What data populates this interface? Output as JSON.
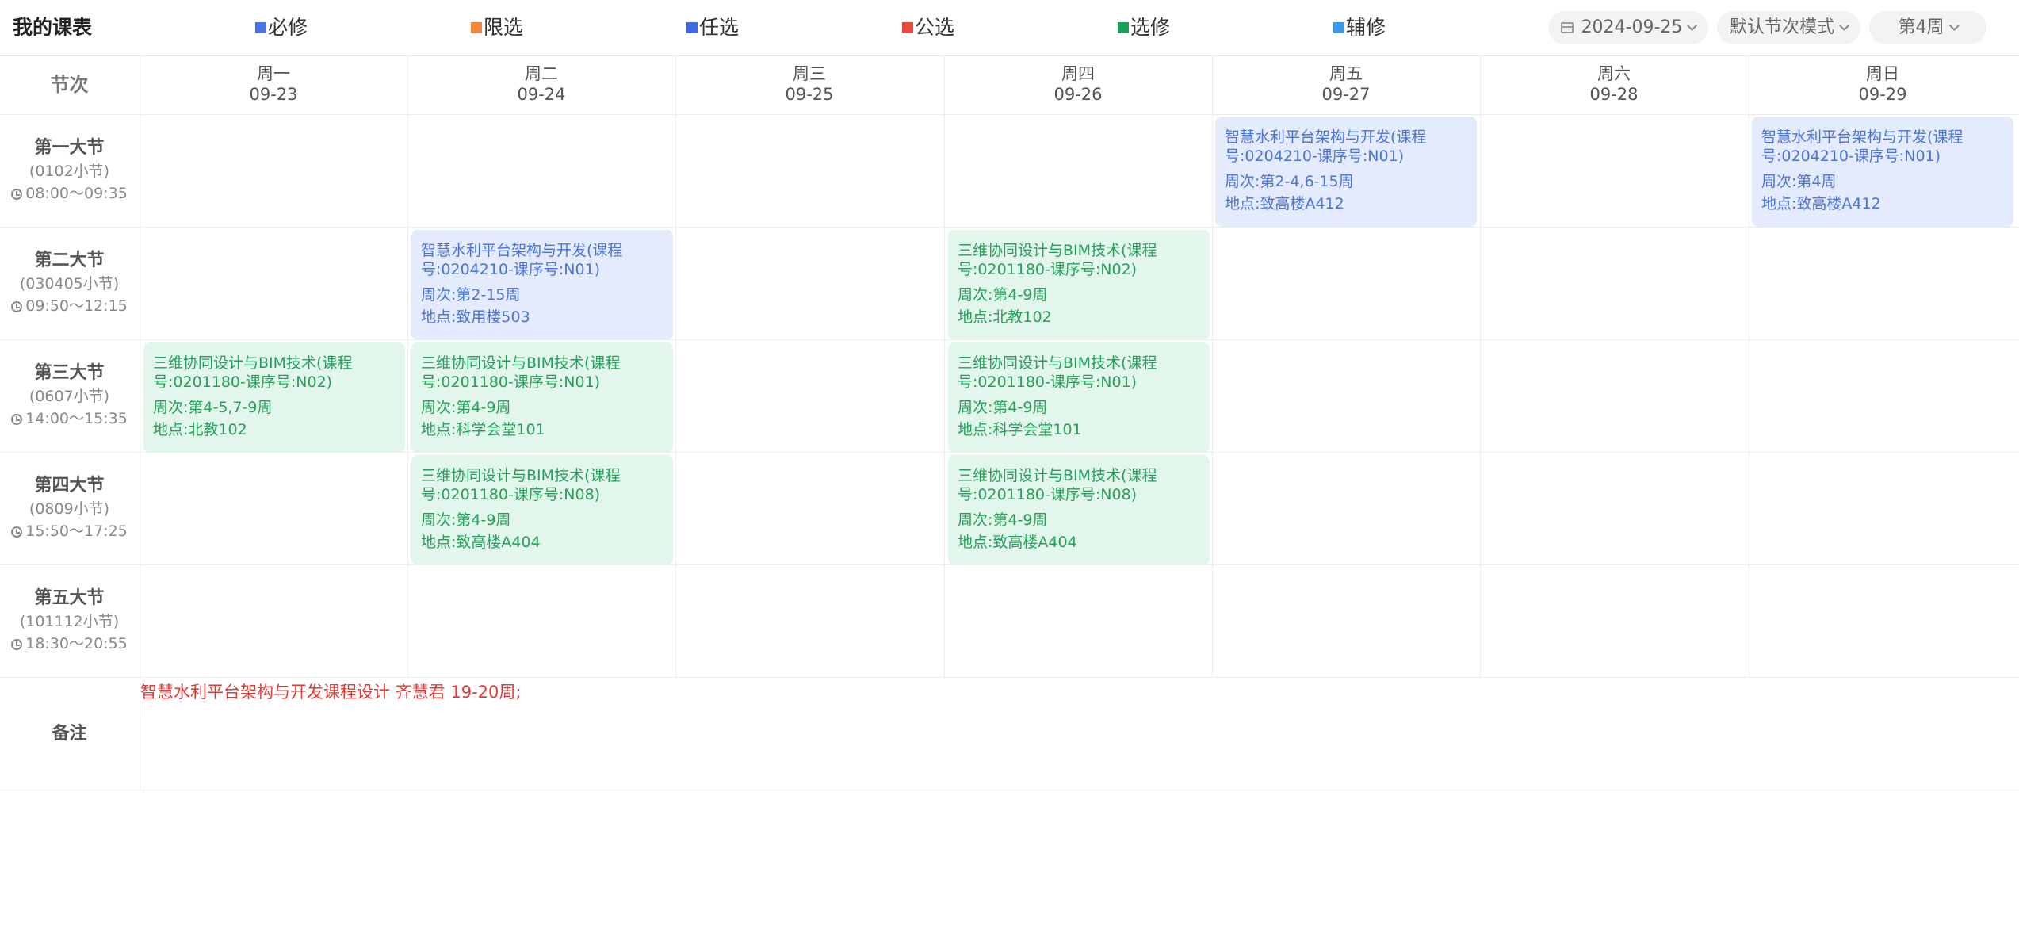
{
  "header": {
    "title": "我的课表",
    "legend": [
      {
        "label": "必修",
        "color": "#4a72e0"
      },
      {
        "label": "限选",
        "color": "#f5873a"
      },
      {
        "label": "任选",
        "color": "#3d6ae0"
      },
      {
        "label": "公选",
        "color": "#e84a3c"
      },
      {
        "label": "选修",
        "color": "#1aa05a"
      },
      {
        "label": "辅修",
        "color": "#3a96e8"
      }
    ],
    "date_value": "2024-09-25",
    "mode_value": "默认节次模式",
    "week_value": "第4周"
  },
  "table": {
    "corner_label": "节次",
    "days": [
      {
        "name": "周一",
        "date": "09-23"
      },
      {
        "name": "周二",
        "date": "09-24"
      },
      {
        "name": "周三",
        "date": "09-25"
      },
      {
        "name": "周四",
        "date": "09-26"
      },
      {
        "name": "周五",
        "date": "09-27"
      },
      {
        "name": "周六",
        "date": "09-28"
      },
      {
        "name": "周日",
        "date": "09-29"
      }
    ],
    "periods": [
      {
        "name": "第一大节",
        "sub": "(0102小节)",
        "time": "08:00～09:35"
      },
      {
        "name": "第二大节",
        "sub": "(030405小节)",
        "time": "09:50～12:15"
      },
      {
        "name": "第三大节",
        "sub": "(0607小节)",
        "time": "14:00～15:35"
      },
      {
        "name": "第四大节",
        "sub": "(0809小节)",
        "time": "15:50～17:25"
      },
      {
        "name": "第五大节",
        "sub": "(101112小节)",
        "time": "18:30～20:55"
      }
    ],
    "courses": [
      {
        "name": "智慧水利平台架构与开发(课程号:0204210-课序号:N01)",
        "weeks": "周次:第2-4,6-15周",
        "location": "地点:致高楼A412",
        "color": "blue"
      },
      {
        "name": "智慧水利平台架构与开发(课程号:0204210-课序号:N01)",
        "weeks": "周次:第4周",
        "location": "地点:致高楼A412",
        "color": "blue"
      },
      {
        "name": "智慧水利平台架构与开发(课程号:0204210-课序号:N01)",
        "weeks": "周次:第2-15周",
        "location": "地点:致用楼503",
        "color": "blue"
      },
      {
        "name": "三维协同设计与BIM技术(课程号:0201180-课序号:N02)",
        "weeks": "周次:第4-9周",
        "location": "地点:北教102",
        "color": "green"
      },
      {
        "name": "三维协同设计与BIM技术(课程号:0201180-课序号:N02)",
        "weeks": "周次:第4-5,7-9周",
        "location": "地点:北教102",
        "color": "green"
      },
      {
        "name": "三维协同设计与BIM技术(课程号:0201180-课序号:N01)",
        "weeks": "周次:第4-9周",
        "location": "地点:科学会堂101",
        "color": "green"
      },
      {
        "name": "三维协同设计与BIM技术(课程号:0201180-课序号:N01)",
        "weeks": "周次:第4-9周",
        "location": "地点:科学会堂101",
        "color": "green"
      },
      {
        "name": "三维协同设计与BIM技术(课程号:0201180-课序号:N08)",
        "weeks": "周次:第4-9周",
        "location": "地点:致高楼A404",
        "color": "green"
      },
      {
        "name": "三维协同设计与BIM技术(课程号:0201180-课序号:N08)",
        "weeks": "周次:第4-9周",
        "location": "地点:致高楼A404",
        "color": "green"
      }
    ],
    "remark_label": "备注",
    "remark_text": "智慧水利平台架构与开发课程设计 齐慧君 19-20周;"
  }
}
